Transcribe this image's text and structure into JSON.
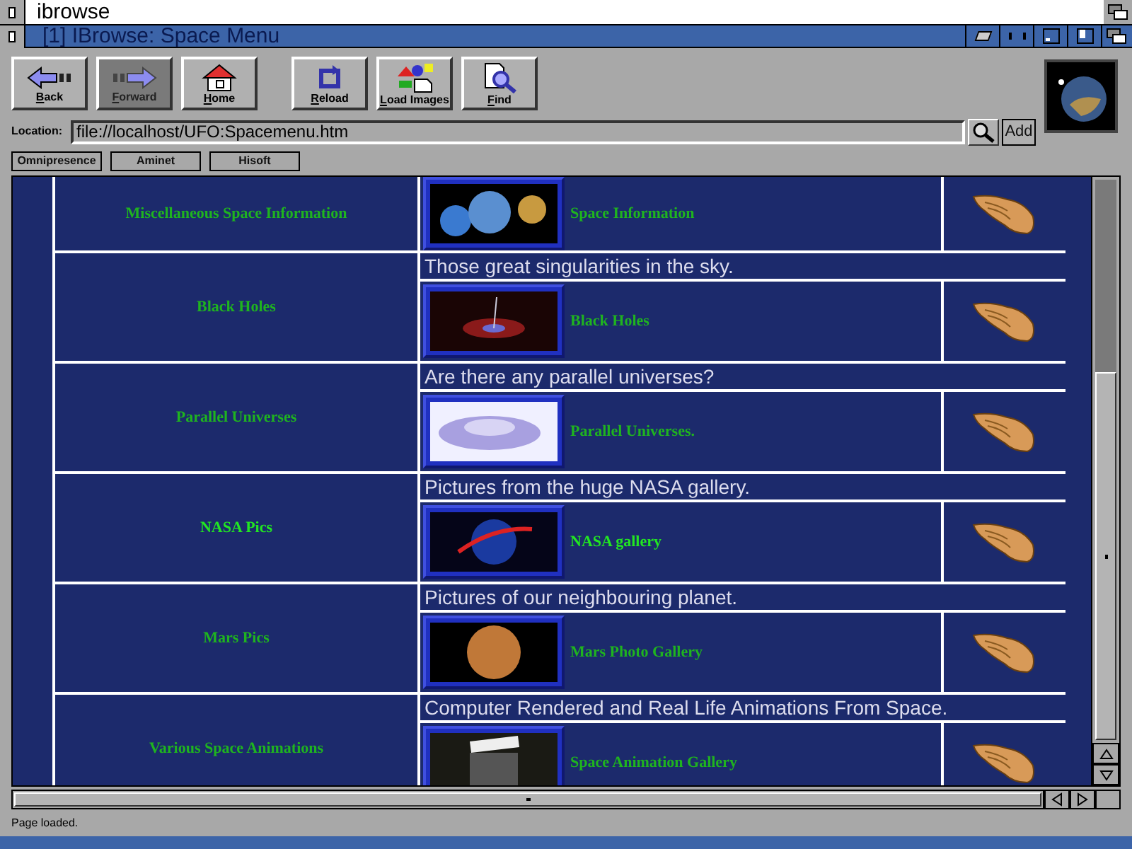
{
  "screen_title": "ibrowse",
  "window": {
    "title": "[1] IBrowse:  Space Menu"
  },
  "toolbar": [
    {
      "label": "Back",
      "kind": "back",
      "disabled": false
    },
    {
      "label": "Forward",
      "kind": "forward",
      "disabled": true
    },
    {
      "label": "Home",
      "kind": "home",
      "disabled": false
    },
    {
      "label": "Reload",
      "kind": "reload",
      "disabled": false
    },
    {
      "label": "Load Images",
      "kind": "images",
      "disabled": false
    },
    {
      "label": "Find",
      "kind": "find",
      "disabled": false
    }
  ],
  "location": {
    "label": "Location:",
    "value": "file://localhost/UFO:Spacemenu.htm",
    "add_button": "Add"
  },
  "hotlist": [
    "Omnipresence",
    "Aminet",
    "Hisoft"
  ],
  "rows": [
    {
      "category": "Miscellaneous Space Information",
      "caption": "",
      "link": "Space Information",
      "color": "#1fb41f",
      "kind": "planets"
    },
    {
      "category": "Black Holes",
      "caption": "Those great singularities in the sky.",
      "link": "Black Holes",
      "color": "#1fb41f",
      "kind": "blackhole"
    },
    {
      "category": "Parallel Universes",
      "caption": "Are there any parallel universes?",
      "link": "Parallel Universes.",
      "color": "#1fb41f",
      "kind": "ufo"
    },
    {
      "category": "NASA Pics",
      "caption": "Pictures from the huge NASA gallery.",
      "link": "NASA gallery",
      "color": "#22e622",
      "kind": "nasa"
    },
    {
      "category": "Mars Pics",
      "caption": "Pictures of our neighbouring planet.",
      "link": "Mars Photo Gallery",
      "color": "#1fb41f",
      "kind": "mars"
    },
    {
      "category": "Various Space Animations",
      "caption": "Computer Rendered and Real Life Animations From Space.",
      "link": "Space Animation Gallery",
      "color": "#1fb41f",
      "kind": "clapper"
    }
  ],
  "status_bar": "Page loaded."
}
